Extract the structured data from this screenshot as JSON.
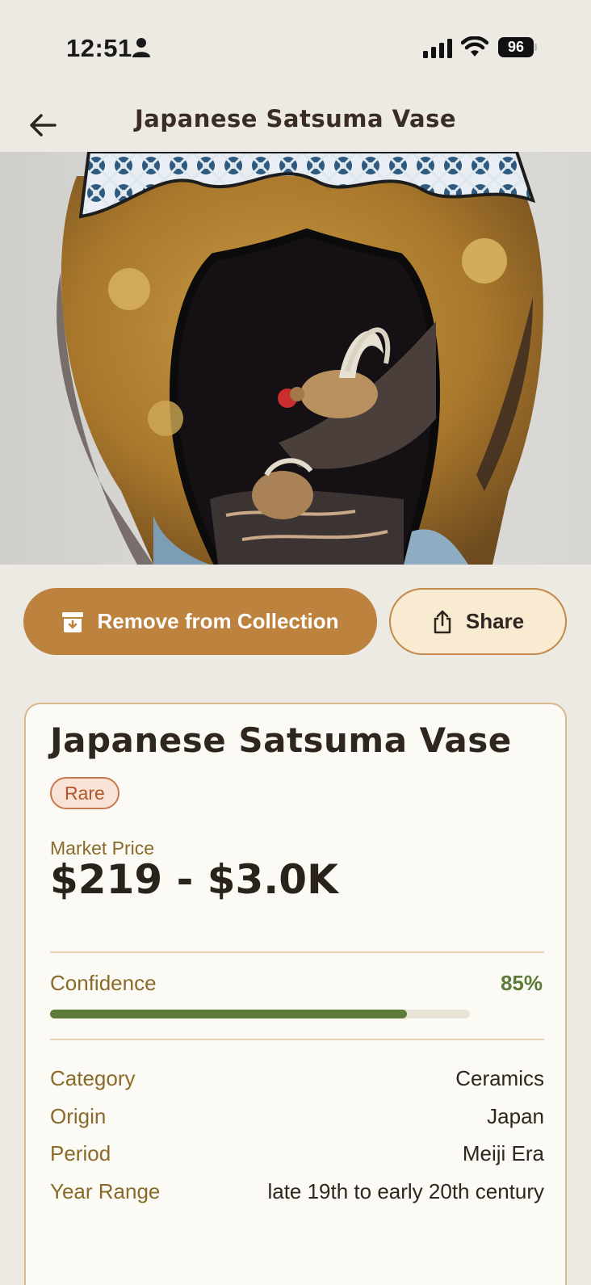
{
  "status_bar": {
    "time": "12:51",
    "battery": "96"
  },
  "nav": {
    "title": "Japanese Satsuma Vase",
    "back_icon": "arrow-left-icon"
  },
  "actions": {
    "remove_label": "Remove from Collection",
    "remove_icon": "archive-icon",
    "share_label": "Share",
    "share_icon": "share-icon"
  },
  "item": {
    "name": "Japanese Satsuma Vase",
    "rarity": "Rare",
    "price_label": "Market Price",
    "price": "$219 - $3.0K",
    "confidence_label": "Confidence",
    "confidence_text": "85%",
    "confidence_value": 0.85,
    "details": [
      {
        "label": "Category",
        "value": "Ceramics"
      },
      {
        "label": "Origin",
        "value": "Japan"
      },
      {
        "label": "Period",
        "value": "Meiji Era"
      },
      {
        "label": "Year Range",
        "value": "late 19th to early 20th century"
      }
    ]
  },
  "colors": {
    "accent": "#BC823E",
    "confidence": "#5C7A3A",
    "rarity": "#B0552C",
    "background": "#ECEAE2"
  }
}
